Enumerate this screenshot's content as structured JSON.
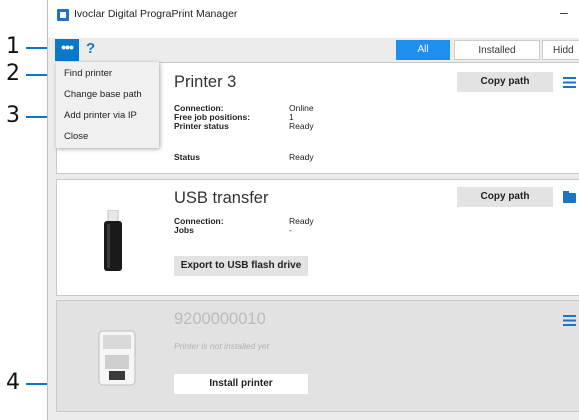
{
  "window": {
    "title": "Ivoclar Digital PrograPrint Manager",
    "minimize_symbol": "–"
  },
  "toolbar": {
    "more_symbol": "•••",
    "help_symbol": "?",
    "filters": [
      "All",
      "Installed",
      "Hidd"
    ],
    "selected_filter": "All"
  },
  "dropdown": {
    "items": [
      "Find printer",
      "Change base path",
      "Add printer via IP",
      "Close"
    ]
  },
  "callouts": [
    "1",
    "2",
    "3",
    "4"
  ],
  "cards": [
    {
      "name": "Printer 3",
      "copy_label": "Copy path",
      "rows": [
        {
          "key": "Connection:",
          "value": "Online"
        },
        {
          "key": "Free job positions:",
          "value": "1"
        },
        {
          "key": "Printer status",
          "value": "Ready"
        },
        {
          "key": "Status",
          "value": "Ready"
        }
      ],
      "side_icon": "menu-icon"
    },
    {
      "name": "USB transfer",
      "copy_label": "Copy path",
      "rows": [
        {
          "key": "Connection:",
          "value": "Ready"
        },
        {
          "key": "Jobs",
          "value": "-"
        }
      ],
      "action_label": "Export to USB flash drive",
      "side_icon": "folder-icon"
    },
    {
      "name": "9200000010",
      "note": "Printer is not installed yet",
      "action_label": "Install printer",
      "side_icon": "menu-icon"
    }
  ],
  "colors": {
    "accent": "#0a78c8",
    "filter_active": "#1e8ff0",
    "icon_blue": "#1b74c8"
  }
}
